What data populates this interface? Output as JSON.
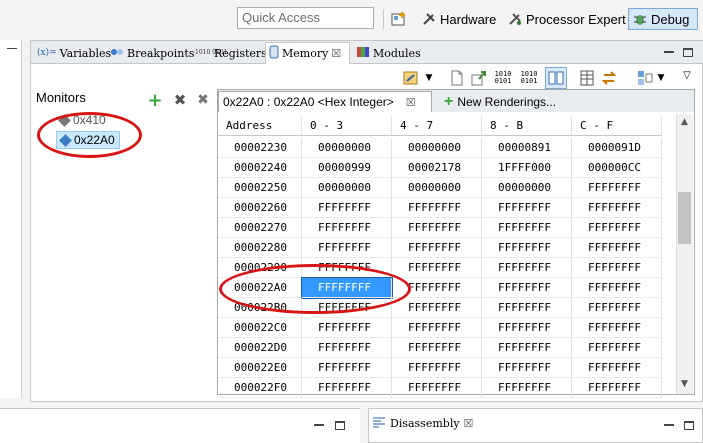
{
  "toolbar": {
    "quick_access_placeholder": "Quick Access",
    "perspectives": [
      {
        "label": "Hardware",
        "icon": "hardware-icon"
      },
      {
        "label": "Processor Expert",
        "icon": "processor-expert-icon"
      },
      {
        "label": "Debug",
        "icon": "debug-icon",
        "active": true
      }
    ]
  },
  "view_tabs": [
    {
      "label": "Variables",
      "prefix": "(x)="
    },
    {
      "label": "Breakpoints"
    },
    {
      "label": "Registers",
      "prefix": "1010 0101"
    },
    {
      "label": "Memory",
      "active": true
    },
    {
      "label": "Modules"
    }
  ],
  "monitors": {
    "label": "Monitors",
    "items": [
      {
        "label": "0x410"
      },
      {
        "label": "0x22A0",
        "selected": true
      }
    ]
  },
  "renderings": {
    "active_tab": "0x22A0 : 0x22A0 <Hex Integer>",
    "new_tab": "New Renderings..."
  },
  "table": {
    "headers": [
      "Address",
      "0 - 3",
      "4 - 7",
      "8 - B",
      "C - F"
    ],
    "rows": [
      [
        "00002230",
        "00000000",
        "00000000",
        "00000891",
        "0000091D"
      ],
      [
        "00002240",
        "00000999",
        "00002178",
        "1FFFF000",
        "000000CC"
      ],
      [
        "00002250",
        "00000000",
        "00000000",
        "00000000",
        "FFFFFFFF"
      ],
      [
        "00002260",
        "FFFFFFFF",
        "FFFFFFFF",
        "FFFFFFFF",
        "FFFFFFFF"
      ],
      [
        "00002270",
        "FFFFFFFF",
        "FFFFFFFF",
        "FFFFFFFF",
        "FFFFFFFF"
      ],
      [
        "00002280",
        "FFFFFFFF",
        "FFFFFFFF",
        "FFFFFFFF",
        "FFFFFFFF"
      ],
      [
        "00002290",
        "FFFFFFFF",
        "FFFFFFFF",
        "FFFFFFFF",
        "FFFFFFFF"
      ],
      [
        "000022A0",
        "FFFFFFFF",
        "FFFFFFFF",
        "FFFFFFFF",
        "FFFFFFFF"
      ],
      [
        "000022B0",
        "FFFFFFFF",
        "FFFFFFFF",
        "FFFFFFFF",
        "FFFFFFFF"
      ],
      [
        "000022C0",
        "FFFFFFFF",
        "FFFFFFFF",
        "FFFFFFFF",
        "FFFFFFFF"
      ],
      [
        "000022D0",
        "FFFFFFFF",
        "FFFFFFFF",
        "FFFFFFFF",
        "FFFFFFFF"
      ],
      [
        "000022E0",
        "FFFFFFFF",
        "FFFFFFFF",
        "FFFFFFFF",
        "FFFFFFFF"
      ],
      [
        "000022F0",
        "FFFFFFFF",
        "FFFFFFFF",
        "FFFFFFFF",
        "FFFFFFFF"
      ]
    ],
    "highlight": {
      "row": 7,
      "col": 1
    }
  },
  "bottom": {
    "disassembly_label": "Disassembly"
  },
  "colors": {
    "selection": "#3399ff",
    "annotation": "#d81515"
  }
}
